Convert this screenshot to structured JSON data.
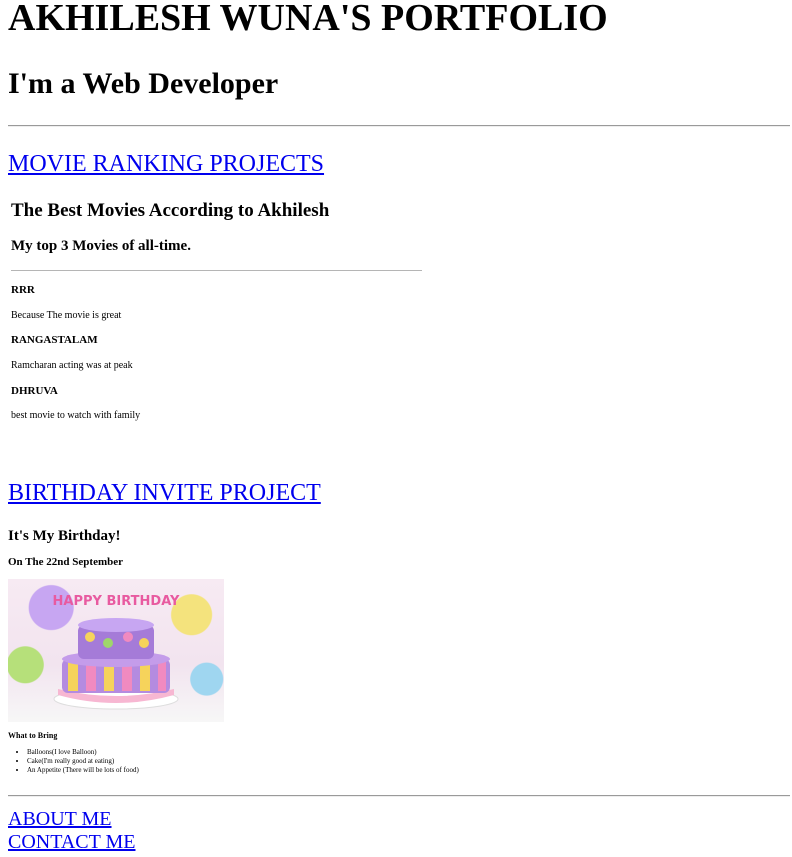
{
  "header": {
    "title": "AKHILESH WUNA'S PORTFOLIO",
    "subtitle": "I'm a Web Developer"
  },
  "projects": {
    "movie_link": "MOVIE RANKING PROJECTS",
    "birthday_link": "BIRTHDAY INVITE PROJECT"
  },
  "movies": {
    "title": "The Best Movies According to Akhilesh",
    "subtitle": "My top 3 Movies of all-time.",
    "items": [
      {
        "name": "RRR",
        "desc": "Because The movie is great"
      },
      {
        "name": "RANGASTALAM",
        "desc": "Ramcharan acting was at peak"
      },
      {
        "name": "DHRUVA",
        "desc": "best movie to watch with family"
      }
    ]
  },
  "birthday": {
    "heading": "It's My Birthday!",
    "date": "On The 22nd September",
    "cake_text": "HAPPY BIRTHDAY",
    "bring_heading": "What to Bring",
    "bring_items": [
      "Balloons(I love Balloon)",
      "Cake(I'm really good at eating)",
      "An Appetite (There will be lots of food)"
    ]
  },
  "footer": {
    "about": "ABOUT ME",
    "contact": "CONTACT ME"
  }
}
